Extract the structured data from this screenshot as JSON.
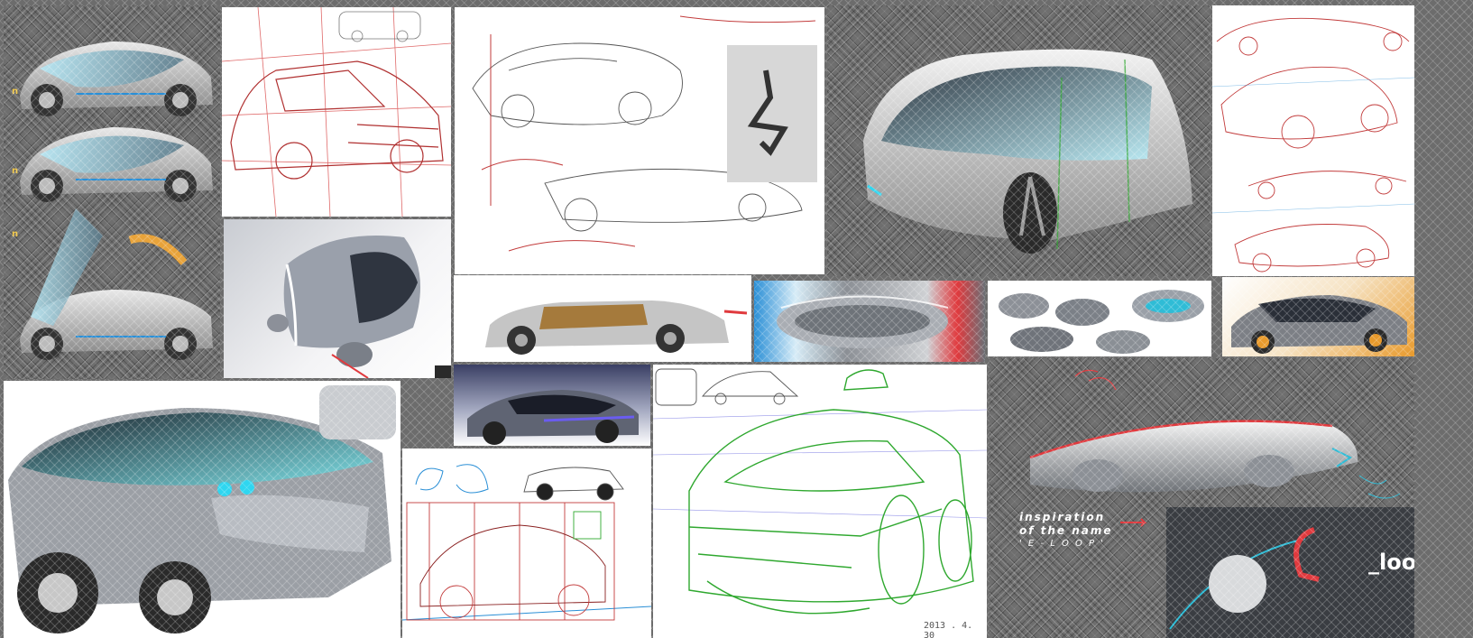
{
  "board": {
    "caption_line1": "inspiration",
    "caption_line2": "of the name",
    "caption_line3": "' E - L O O P '",
    "loop_text": "_loop",
    "sketch_date": "2013 . 4. 30",
    "step_marks": [
      "n",
      "n",
      "n"
    ]
  },
  "colors": {
    "accent_red": "#e03a3e",
    "accent_blue": "#2a8fd6",
    "accent_green": "#2fa82f",
    "accent_orange": "#e89a2c",
    "glass_cyan": "#9fe3f0"
  }
}
